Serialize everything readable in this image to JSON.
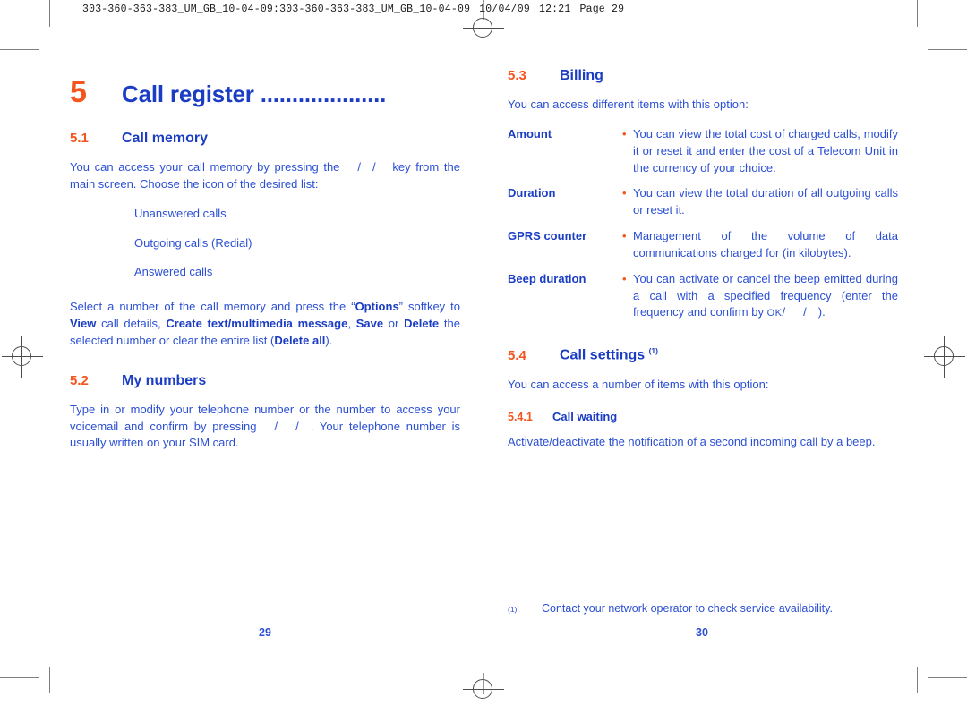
{
  "print_slug": {
    "file_ref": "303-360-363-383_UM_GB_10-04-09:303-360-363-383_UM_GB_10-04-09",
    "date": "10/04/09",
    "time": "12:21",
    "page_label": "Page 29"
  },
  "left_page": {
    "folio": "29",
    "chapter": {
      "number": "5",
      "title": "Call register ...................."
    },
    "sections": [
      {
        "number": "5.1",
        "title": "Call memory",
        "intro_before_key": "You can access your call memory by pressing the",
        "intro_after_key": "key from the main screen. Choose the icon of the desired list:",
        "list": [
          "Unanswered calls",
          "Outgoing calls (Redial)",
          "Answered calls"
        ],
        "options_paragraph": {
          "p1": "Select a number of the call memory and press the “",
          "b1": "Options",
          "p2": "” softkey to ",
          "b2": "View",
          "p3": " call details, ",
          "b3": "Create text/multimedia message",
          "p4": ", ",
          "b4": "Save",
          "p5": " or ",
          "b5": "Delete",
          "p6": " the selected number or clear the entire list (",
          "b6": "Delete all",
          "p7": ")."
        }
      },
      {
        "number": "5.2",
        "title": "My numbers",
        "body_before_key": "Type in or modify your telephone number or the number to access your voicemail and confirm by pressing",
        "body_after_key": ". Your telephone number is usually written on your SIM card."
      }
    ]
  },
  "right_page": {
    "folio": "30",
    "sections": [
      {
        "number": "5.3",
        "title": "Billing",
        "intro": "You can access different items with this option:",
        "definitions": [
          {
            "term": "Amount",
            "bullet": "•",
            "description": "You can view the total cost of charged calls, modify it or reset it and enter the cost of a Telecom Unit in the currency of your choice."
          },
          {
            "term": "Duration",
            "bullet": "•",
            "description": "You can view the total duration of all outgoing calls or reset it."
          },
          {
            "term": "GPRS counter",
            "bullet": "•",
            "description": "Management of the volume of data communications charged for (in kilobytes)."
          },
          {
            "term": "Beep duration",
            "bullet": "•",
            "description_before_key": "You can activate or cancel the beep emitted during a call with a specified frequency (enter the frequency and confirm by",
            "ok_key_label": "OK",
            "description_after_key": ")."
          }
        ]
      },
      {
        "number": "5.4",
        "title": "Call settings",
        "footnote_marker": "(1)",
        "intro": "You can access a number of items with this option:",
        "subsections": [
          {
            "number": "5.4.1",
            "title": "Call waiting",
            "body": "Activate/deactivate the notification of a second incoming call by a beep."
          }
        ]
      }
    ],
    "footnote": {
      "marker": "(1)",
      "text": "Contact your network operator to check service availability."
    }
  },
  "colors": {
    "heading_blue": "#1b3dc4",
    "body_blue": "#2b4fd4",
    "accent_orange": "#f4551e",
    "mark_gray": "#4d4d4d"
  }
}
